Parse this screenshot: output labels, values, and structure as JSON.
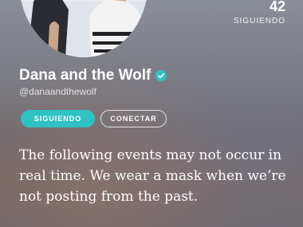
{
  "profile": {
    "name": "Dana and the Wolf",
    "handle": "@danaandthewolf",
    "verified": true,
    "avatar": "profile-photo"
  },
  "stats": {
    "following_count": "42",
    "following_label": "SIGUIENDO"
  },
  "buttons": {
    "following_label": "SIGUIENDO",
    "connect_label": "CONECTAR"
  },
  "bio": {
    "text": "The following events may not occur in real time. We wear a mask when we’re not posting from the past."
  },
  "colors": {
    "accent": "#2fc2c4",
    "verified": "#2fc2c4",
    "text": "#ffffff"
  }
}
